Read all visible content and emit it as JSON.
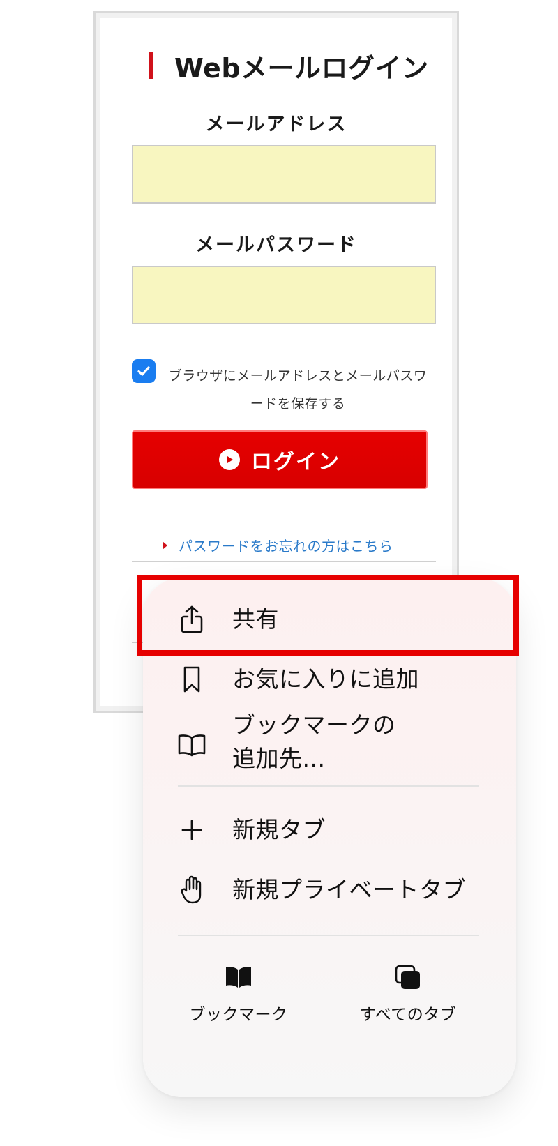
{
  "login_card": {
    "title": "Webメールログイン",
    "email_label": "メールアドレス",
    "email_value": "",
    "password_label": "メールパスワード",
    "password_value": "",
    "remember_checked": true,
    "remember_text": "ブラウザにメールアドレスとメールパスワードを保存する",
    "login_button": "ログイン",
    "forgot_link": "パスワードをお忘れの方はこちら"
  },
  "context_menu": {
    "items": [
      {
        "label": "共有",
        "icon": "share-icon"
      },
      {
        "label": "お気に入りに追加",
        "icon": "bookmark-icon"
      },
      {
        "label": "ブックマークの\n追加先...",
        "icon": "open-book-icon"
      },
      {
        "label": "新規タブ",
        "icon": "plus-icon"
      },
      {
        "label": "新規プライベートタブ",
        "icon": "hand-icon"
      }
    ],
    "bottom": [
      {
        "label": "ブックマーク",
        "icon": "bookmarks-book-icon"
      },
      {
        "label": "すべてのタブ",
        "icon": "all-tabs-icon"
      }
    ]
  },
  "colors": {
    "accent_red": "#e60000",
    "field_bg": "#f8f6c0",
    "link_blue": "#2a7ac9",
    "checkbox_blue": "#1a7df0"
  }
}
